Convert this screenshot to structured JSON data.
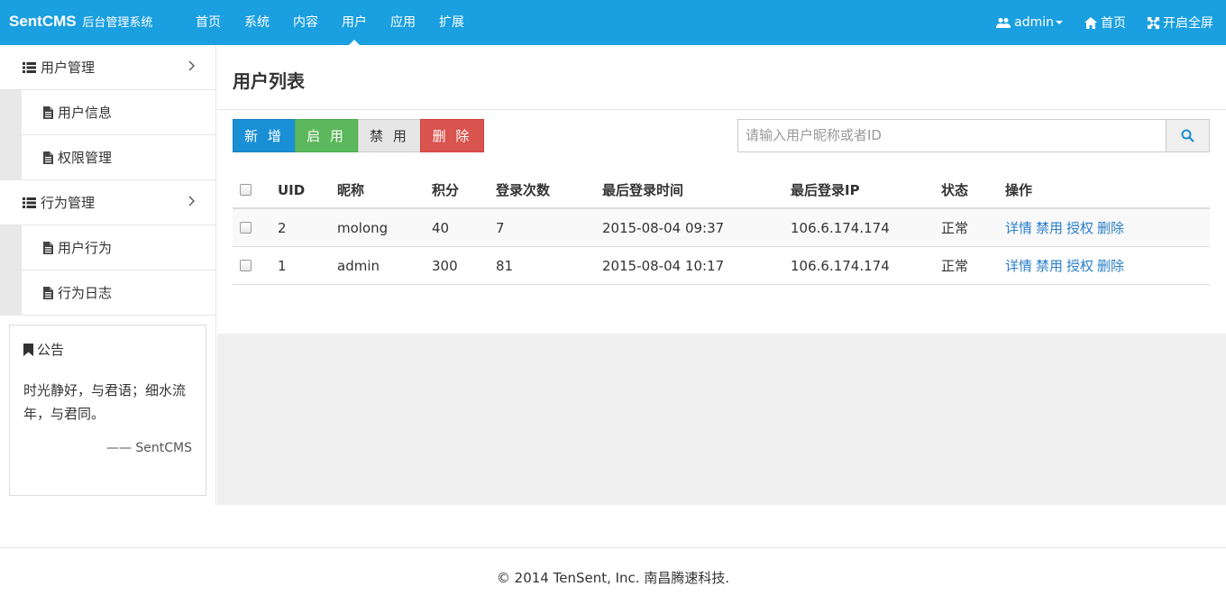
{
  "brand": {
    "name": "SentCMS",
    "subtitle": "后台管理系统"
  },
  "nav": {
    "items": [
      {
        "label": "首页"
      },
      {
        "label": "系统"
      },
      {
        "label": "内容"
      },
      {
        "label": "用户",
        "active": true
      },
      {
        "label": "应用"
      },
      {
        "label": "扩展"
      }
    ],
    "right": {
      "user": "admin",
      "home": "首页",
      "fullscreen": "开启全屏"
    }
  },
  "sidebar": {
    "groups": [
      {
        "label": "用户管理",
        "items": [
          {
            "label": "用户信息"
          },
          {
            "label": "权限管理"
          }
        ]
      },
      {
        "label": "行为管理",
        "items": [
          {
            "label": "用户行为"
          },
          {
            "label": "行为日志"
          }
        ]
      }
    ],
    "notice": {
      "title": "公告",
      "text": "时光静好，与君语；细水流年，与君同。",
      "sign": "—— SentCMS"
    }
  },
  "main": {
    "title": "用户列表",
    "buttons": {
      "add": "新 增",
      "enable": "启 用",
      "disable": "禁 用",
      "delete": "删 除"
    },
    "search": {
      "placeholder": "请输入用户昵称或者ID"
    },
    "table": {
      "headers": {
        "uid": "UID",
        "nickname": "昵称",
        "score": "积分",
        "login_count": "登录次数",
        "last_time": "最后登录时间",
        "last_ip": "最后登录IP",
        "status": "状态",
        "ops": "操作"
      },
      "rows": [
        {
          "uid": "2",
          "nickname": "molong",
          "score": "40",
          "login_count": "7",
          "last_time": "2015-08-04 09:37",
          "last_ip": "106.6.174.174",
          "status": "正常"
        },
        {
          "uid": "1",
          "nickname": "admin",
          "score": "300",
          "login_count": "81",
          "last_time": "2015-08-04 10:17",
          "last_ip": "106.6.174.174",
          "status": "正常"
        }
      ],
      "ops": {
        "detail": "详情",
        "disable": "禁用",
        "auth": "授权",
        "delete": "删除"
      }
    }
  },
  "footer": {
    "text": "© 2014 TenSent, Inc. 南昌腾速科技."
  },
  "colors": {
    "topbar": "#1a9fe0",
    "primary": "#1a8fd6",
    "success": "#5cb85c",
    "danger": "#d9534f",
    "link": "#2a7fc9"
  }
}
